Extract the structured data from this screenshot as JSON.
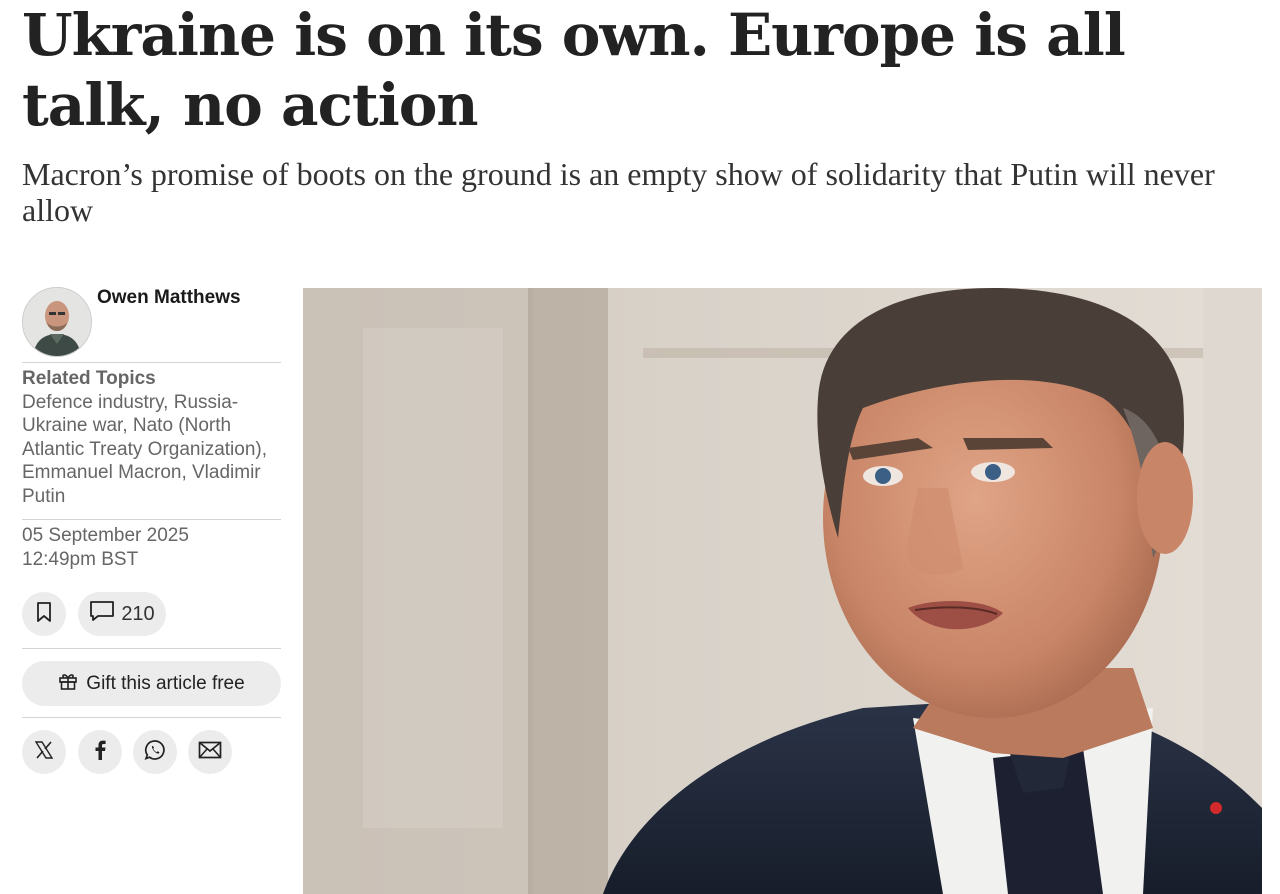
{
  "article": {
    "headline": "Ukraine is on its own. Europe is all talk, no action",
    "standfirst": "Macron’s promise of boots on the ground is an empty show of solidarity that Putin will never allow"
  },
  "author": {
    "name": "Owen Matthews"
  },
  "topics": {
    "heading": "Related Topics",
    "list": "Defence industry, Russia-Ukraine war, Nato (North Atlantic Treaty Organization), Emmanuel Macron, Vladimir Putin"
  },
  "dateline": {
    "date": "05 September 2025",
    "time": "12:49pm BST"
  },
  "actions": {
    "comment_count": "210",
    "gift_label": "Gift this article free"
  },
  "icons": {
    "bookmark": "bookmark-icon",
    "comment": "comment-icon",
    "gift": "gift-icon",
    "share": [
      "x-icon",
      "facebook-icon",
      "whatsapp-icon",
      "email-icon"
    ]
  },
  "colors": {
    "button_bg": "#ececec",
    "muted_text": "#666666",
    "headline_text": "#222222"
  }
}
